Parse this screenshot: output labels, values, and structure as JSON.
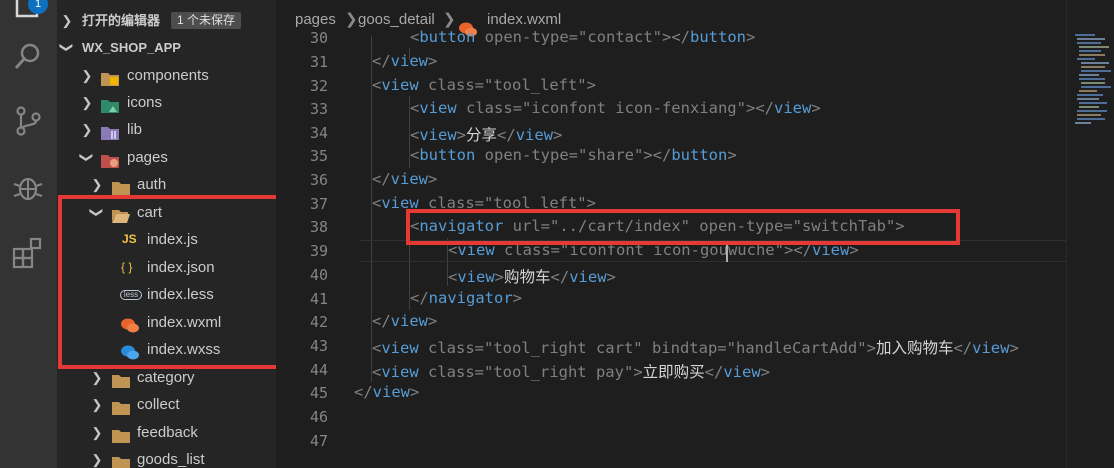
{
  "activity_bar": {
    "badge": "1",
    "icons": [
      "explorer-icon",
      "search-icon",
      "source-control-icon",
      "debug-icon",
      "extensions-icon"
    ]
  },
  "sidebar": {
    "open_editors": {
      "label": "打开的编辑器",
      "unsaved": "1 个未保存"
    },
    "project": "WX_SHOP_APP",
    "tree": [
      {
        "label": "components",
        "icon": "folder-components-icon",
        "state": "collapsed"
      },
      {
        "label": "icons",
        "icon": "folder-images-icon",
        "state": "collapsed"
      },
      {
        "label": "lib",
        "icon": "folder-lib-icon",
        "state": "collapsed"
      },
      {
        "label": "pages",
        "icon": "folder-pages-icon",
        "state": "expanded"
      },
      {
        "label": "auth",
        "icon": "folder-icon",
        "state": "collapsed"
      },
      {
        "label": "cart",
        "icon": "folder-open-icon",
        "state": "expanded"
      },
      {
        "label": "index.js",
        "icon": "js-file-icon",
        "badge": "JS"
      },
      {
        "label": "index.json",
        "icon": "json-file-icon",
        "badge": "{ }"
      },
      {
        "label": "index.less",
        "icon": "less-file-icon",
        "badge": "less"
      },
      {
        "label": "index.wxml",
        "icon": "wxml-file-icon"
      },
      {
        "label": "index.wxss",
        "icon": "wxss-file-icon"
      },
      {
        "label": "category",
        "icon": "folder-icon",
        "state": "collapsed"
      },
      {
        "label": "collect",
        "icon": "folder-icon",
        "state": "collapsed"
      },
      {
        "label": "feedback",
        "icon": "folder-icon",
        "state": "collapsed"
      },
      {
        "label": "goods_list",
        "icon": "folder-icon",
        "state": "collapsed"
      }
    ]
  },
  "editor": {
    "breadcrumb": [
      "pages",
      "goos_detail",
      "index.wxml"
    ],
    "lines": [
      {
        "n": "30",
        "text": "<button open-type=\"contact\"></button>"
      },
      {
        "n": "31",
        "text": "</view>"
      },
      {
        "n": "32",
        "text": "<view class=\"tool_left\">"
      },
      {
        "n": "33",
        "text": "<view class=\"iconfont icon-fenxiang\"></view>"
      },
      {
        "n": "34",
        "text": "<view>分享</view>"
      },
      {
        "n": "35",
        "text": "<button open-type=\"share\"></button>"
      },
      {
        "n": "36",
        "text": "</view>"
      },
      {
        "n": "37",
        "text": "<view class=\"tool_left\">"
      },
      {
        "n": "38",
        "text": "<navigator url=\"../cart/index\" open-type=\"switchTab\">"
      },
      {
        "n": "39",
        "text": "<view class=\"iconfont icon-gouwuche\"></view>"
      },
      {
        "n": "40",
        "text": "<view>购物车</view>"
      },
      {
        "n": "41",
        "text": "</navigator>"
      },
      {
        "n": "42",
        "text": "</view>"
      },
      {
        "n": "43",
        "text": "<view class=\"tool_right cart\" bindtap=\"handleCartAdd\">加入购物车</view>"
      },
      {
        "n": "44",
        "text": "<view class=\"tool_right pay\">立即购买</view>"
      },
      {
        "n": "45",
        "text": "</view>"
      },
      {
        "n": "46",
        "text": ""
      },
      {
        "n": "47",
        "text": ""
      }
    ]
  },
  "colors": {
    "highlight": "#e53935",
    "tag": "#569cd6",
    "attr": "#9cdcfe",
    "string": "#ce9178"
  }
}
